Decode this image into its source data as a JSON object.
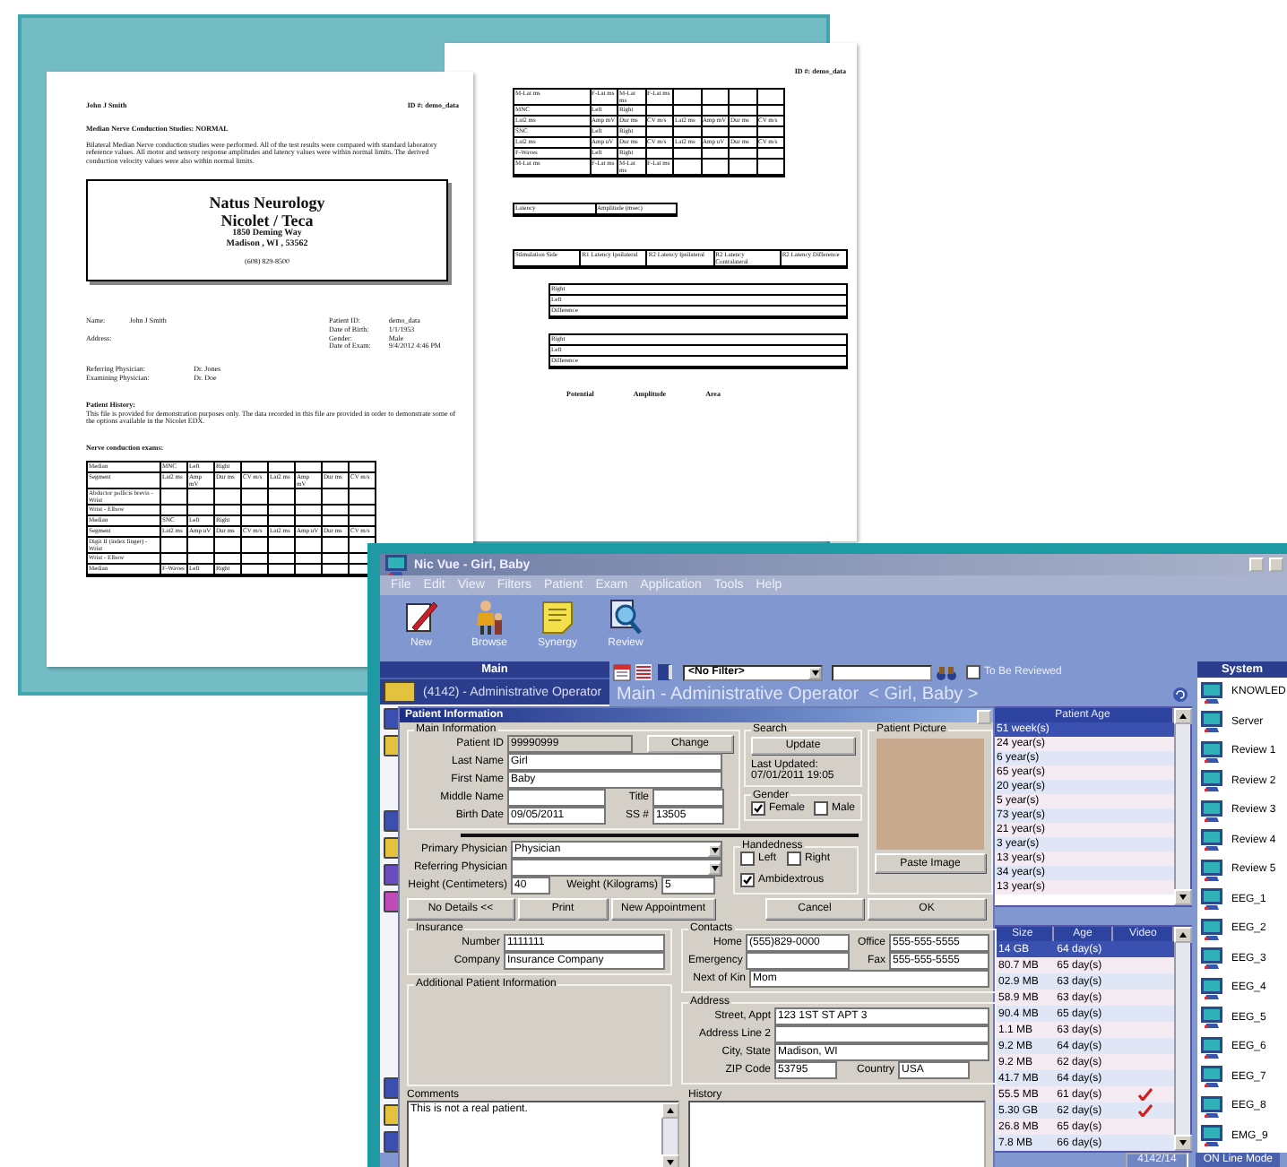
{
  "report_page": {
    "header_name": "John J Smith",
    "header_id": "ID #: demo_data",
    "heading": "Median Nerve Conduction Studies: NORMAL",
    "summary": "Bilateral Median Nerve conduction studies were performed. All of the test results were compared with standard laboratory reference values. All motor and sensory response amplitudes and latency values were within normal limits. The derived conduction velocity values were also within normal limits.",
    "letterhead": [
      "Natus Neurology",
      "Nicolet / Teca",
      "1850 Deming Way",
      "Madison , WI , 53562",
      "(608) 829-8500"
    ],
    "patient_fields": [
      {
        "label": "Name:",
        "value": "John J Smith"
      },
      {
        "label": "Address:"
      }
    ],
    "exam_fields": [
      {
        "label": "Patient ID:",
        "value": "demo_data"
      },
      {
        "label": "Date of Birth:",
        "value": "1/1/1953"
      },
      {
        "label": "Gender:",
        "value": "Male"
      },
      {
        "label": "Date of Exam:",
        "value": "9/4/2012 4:46 PM"
      }
    ],
    "physicians": [
      {
        "label": "Referring Physician:",
        "value": "Dr. Jones"
      },
      {
        "label": "Examining Physician:",
        "value": "Dr. Doe"
      }
    ],
    "history_title": "Patient History:",
    "history": "This file is provided for demonstration purposes only. The data recorded in this file are provided in order to demonstrate some of the options available in the Nicolet EDX.",
    "exams_title": "Nerve conduction exams:",
    "table": [
      [
        "Median",
        "MNC",
        "Left",
        "Right"
      ],
      [
        "Segment",
        "Lat2 ms",
        "Amp mV",
        "Dur ms",
        "CV m/s",
        "Lat2 ms",
        "Amp mV",
        "Dur ms",
        "CV m/s"
      ],
      [
        "Abductor pollicis brevis - Wrist"
      ],
      [
        "Wrist - Elbow"
      ],
      [
        "Median",
        "SNC",
        "Left",
        "Right"
      ],
      [
        "Segment",
        "Lat2 ms",
        "Amp uV",
        "Dur ms",
        "CV m/s",
        "Lat2 ms",
        "Amp uV",
        "Dur ms",
        "CV m/s"
      ],
      [
        "Digit II (index finger) - Wrist"
      ],
      [
        "Wrist - Elbow"
      ],
      [
        "Median",
        "F-Waves",
        "Left",
        "Right"
      ]
    ]
  },
  "report_page_2": {
    "header_id": "ID #: demo_data",
    "nerve_table": [
      [
        "M-Lat ms",
        "F-Lat ms",
        "M-Lat ms",
        "F-Lat ms"
      ],
      [
        "MNC",
        "Left",
        "Right"
      ],
      [
        "Lat2 ms",
        "Amp mV",
        "Dur ms",
        "CV m/s",
        "Lat2 ms",
        "Amp mV",
        "Dur ms",
        "CV m/s"
      ],
      [
        "SNC",
        "Left",
        "Right"
      ],
      [
        "Lat2 ms",
        "Amp uV",
        "Dur ms",
        "CV m/s",
        "Lat2 ms",
        "Amp uV",
        "Dur ms",
        "CV m/s"
      ],
      [
        "F-Waves",
        "Left",
        "Right"
      ],
      [
        "M-Lat ms",
        "F-Lat ms",
        "M-Lat ms",
        "F-Lat ms"
      ]
    ],
    "latency_table": [
      [
        "Latency",
        "Amplitude (msec)"
      ]
    ],
    "blink_header": [
      [
        "Stimulation Side",
        "R1 Latency Ipsilateral",
        "R2 Latency Ipsilateral",
        "R2 Latency Contralateral",
        "R2 Latency Difference"
      ]
    ],
    "blink_tables": [
      [
        [
          "Right"
        ],
        [
          "Left"
        ],
        [
          "Difference"
        ]
      ],
      [
        [
          "Right"
        ],
        [
          "Left"
        ],
        [
          "Difference"
        ]
      ]
    ],
    "footer_labels": [
      "Potential",
      "Amplitude",
      "Area"
    ]
  },
  "window": {
    "title": "Nic Vue - Girl, Baby"
  },
  "menu": [
    "File",
    "Edit",
    "View",
    "Filters",
    "Patient",
    "Exam",
    "Application",
    "Tools",
    "Help"
  ],
  "toolbar": [
    {
      "label": "New",
      "kind": "pen"
    },
    {
      "label": "Browse",
      "kind": "person"
    },
    {
      "label": "Synergy",
      "kind": "notes"
    },
    {
      "label": "Review",
      "kind": "magnifier"
    }
  ],
  "main_panel": {
    "title": "Main",
    "operator": {
      "label": "(4142) - Administrative Operator",
      "color": "#e4c23e"
    },
    "folder_groups": [
      [
        {
          "color": "#3a4fb0"
        },
        {
          "color": "#e4c23e"
        }
      ],
      [
        {
          "color": "#3a4fb0"
        },
        {
          "color": "#e4c23e"
        },
        {
          "color": "#6a4bc0"
        },
        {
          "color": "#c04ab8"
        }
      ],
      [
        {
          "color": "#3a4fb0"
        },
        {
          "color": "#e4c23e"
        },
        {
          "color": "#3a4fb0"
        }
      ]
    ]
  },
  "filter_bar": {
    "filter": "<No Filter>",
    "to_be_reviewed": {
      "label": "To Be Reviewed",
      "checked": false
    }
  },
  "heading": "Main - Administrative Operator  < Girl, Baby >",
  "patient_dialog": {
    "title": "Patient Information",
    "main_information": {
      "title": "Main Information",
      "patient_id": {
        "label": "Patient ID",
        "value": "99990999",
        "disabled": true
      },
      "change_button": "Change",
      "last_name": {
        "label": "Last Name",
        "value": "Girl"
      },
      "first_name": {
        "label": "First Name",
        "value": "Baby"
      },
      "middle_name": {
        "label": "Middle Name"
      },
      "title_field": {
        "label": "Title"
      },
      "birth_date": {
        "label": "Birth Date",
        "value": "09/05/2011"
      },
      "ssn": {
        "label": "SS #",
        "value": "13505"
      }
    },
    "primary_physician": {
      "label": "Primary Physician",
      "value": "Physician"
    },
    "referring_physician": {
      "label": "Referring Physician"
    },
    "height": {
      "label": "Height (Centimeters)",
      "value": "40"
    },
    "weight": {
      "label": "Weight (Kilograms)",
      "value": "5"
    },
    "search": {
      "title": "Search",
      "button": "Update",
      "last_updated": "Last Updated:",
      "date": "07/01/2011 19:05"
    },
    "gender": {
      "title": "Gender",
      "options": [
        {
          "label": "Female",
          "checked": true
        },
        {
          "label": "Male",
          "checked": false
        }
      ]
    },
    "handedness": {
      "title": "Handedness",
      "options": [
        {
          "label": "Left",
          "checked": false
        },
        {
          "label": "Right",
          "checked": false
        },
        {
          "label": "Ambidextrous",
          "checked": true
        }
      ]
    },
    "picture": {
      "title": "Patient Picture",
      "button": "Paste Image"
    },
    "buttons": [
      "No Details <<",
      "Print",
      "New Appointment",
      "Cancel",
      "OK"
    ],
    "insurance": {
      "title": "Insurance",
      "fields": [
        {
          "label": "Number",
          "value": "1111111"
        },
        {
          "label": "Company",
          "value": "Insurance Company"
        }
      ]
    },
    "additional": {
      "title": "Additional Patient Information"
    },
    "contacts": {
      "title": "Contacts",
      "fields": [
        {
          "label": "Home",
          "value": "(555)829-0000"
        },
        {
          "label": "Office",
          "value": "555-555-5555"
        },
        {
          "label": "Emergency"
        },
        {
          "label": "Fax",
          "value": "555-555-5555"
        },
        {
          "label": "Next of Kin",
          "value": "Mom"
        }
      ]
    },
    "address": {
      "title": "Address",
      "fields": [
        {
          "label": "Street, Appt",
          "value": "123 1ST ST APT 3"
        },
        {
          "label": "Address Line 2"
        },
        {
          "label": "City, State",
          "value": "Madison, WI"
        },
        {
          "label": "ZIP Code",
          "value": "53795"
        },
        {
          "label": "Country",
          "value": "USA"
        }
      ]
    },
    "comments": {
      "label": "Comments",
      "value": "This is not a real patient."
    },
    "history": {
      "label": "History"
    }
  },
  "age_list": {
    "header": "Patient Age",
    "rows": [
      {
        "age": "51 week(s)",
        "selected": true
      },
      {
        "age": "24 year(s)",
        "selected": false
      },
      {
        "age": "6 year(s)",
        "selected": false
      },
      {
        "age": "65 year(s)",
        "selected": false
      },
      {
        "age": "20 year(s)",
        "selected": false
      },
      {
        "age": "5 year(s)",
        "selected": false
      },
      {
        "age": "73 year(s)",
        "selected": false
      },
      {
        "age": "21 year(s)",
        "selected": false
      },
      {
        "age": "3 year(s)",
        "selected": false
      },
      {
        "age": "13 year(s)",
        "selected": false
      },
      {
        "age": "34 year(s)",
        "selected": false
      },
      {
        "age": "13 year(s)",
        "selected": false
      }
    ]
  },
  "exam_list": {
    "columns": [
      "Size",
      "Age",
      "Video"
    ],
    "rows": [
      {
        "size": "14 GB",
        "age": "64 day(s)",
        "video": false,
        "selected": true
      },
      {
        "size": "80.7 MB",
        "age": "65 day(s)",
        "video": false,
        "selected": false
      },
      {
        "size": "02.9 MB",
        "age": "63 day(s)",
        "video": false,
        "selected": false
      },
      {
        "size": "58.9 MB",
        "age": "63 day(s)",
        "video": false,
        "selected": false
      },
      {
        "size": "90.4 MB",
        "age": "65 day(s)",
        "video": false,
        "selected": false
      },
      {
        "size": "1.1 MB",
        "age": "63 day(s)",
        "video": false,
        "selected": false
      },
      {
        "size": "9.2 MB",
        "age": "64 day(s)",
        "video": false,
        "selected": false
      },
      {
        "size": "9.2 MB",
        "age": "62 day(s)",
        "video": false,
        "selected": false
      },
      {
        "size": "41.7 MB",
        "age": "64 day(s)",
        "video": false,
        "selected": false
      },
      {
        "size": "55.5 MB",
        "age": "61 day(s)",
        "video": true,
        "selected": false
      },
      {
        "size": "5.30 GB",
        "age": "62 day(s)",
        "video": true,
        "selected": false
      },
      {
        "size": "26.8 MB",
        "age": "65 day(s)",
        "video": false,
        "selected": false
      },
      {
        "size": "7.8 MB",
        "age": "66 day(s)",
        "video": false,
        "selected": false
      }
    ]
  },
  "system": {
    "title": "System",
    "items": [
      "KNOWLED",
      "Server",
      "Review 1",
      "Review 2",
      "Review 3",
      "Review 4",
      "Review 5",
      "EEG_1",
      "EEG_2",
      "EEG_3",
      "EEG_4",
      "EEG_5",
      "EEG_6",
      "EEG_7",
      "EEG_8",
      "EMG_9"
    ]
  },
  "status_bar": {
    "count": "4142/14",
    "mode": "ON Line Mode"
  }
}
